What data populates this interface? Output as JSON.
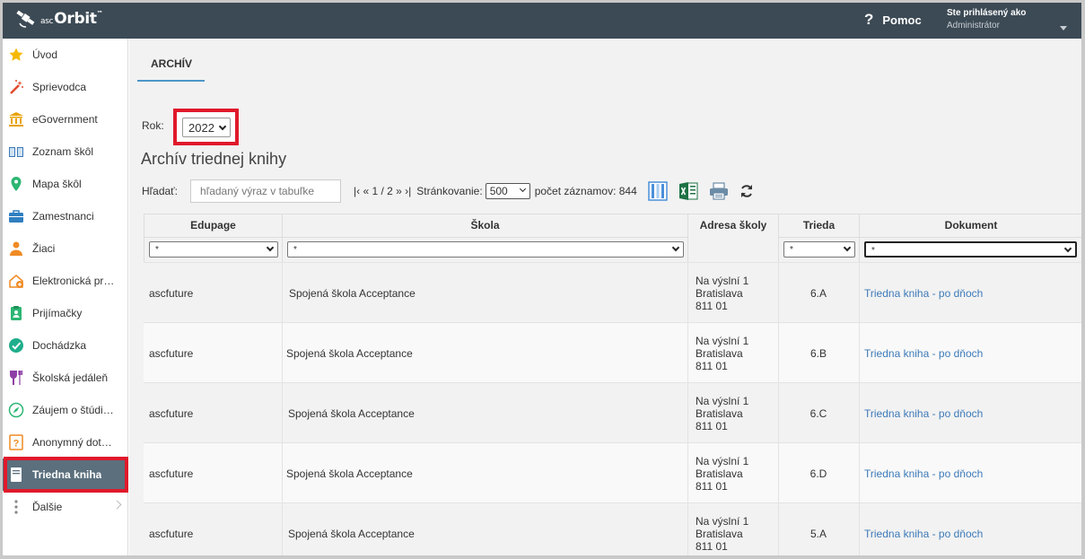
{
  "header": {
    "logo_small": "asc",
    "logo_text": "Orbit",
    "logo_tm": "™",
    "help_icon": "?",
    "help_label": "Pomoc",
    "user_line1": "Ste prihlásený ako",
    "user_line2": "Administrátor"
  },
  "sidebar": {
    "items": [
      {
        "label": "Úvod",
        "icon": "star-icon",
        "active": false
      },
      {
        "label": "Sprievodca",
        "icon": "wand-icon",
        "active": false
      },
      {
        "label": "eGovernment",
        "icon": "bank-icon",
        "active": false
      },
      {
        "label": "Zoznam škôl",
        "icon": "book-icon",
        "active": false
      },
      {
        "label": "Mapa škôl",
        "icon": "map-pin-icon",
        "active": false
      },
      {
        "label": "Zamestnanci",
        "icon": "briefcase-icon",
        "active": false
      },
      {
        "label": "Žiaci",
        "icon": "student-icon",
        "active": false
      },
      {
        "label": "Elektronická pr…",
        "icon": "application-icon",
        "active": false
      },
      {
        "label": "Prijímačky",
        "icon": "clipboard-user-icon",
        "active": false
      },
      {
        "label": "Dochádzka",
        "icon": "check-circle-icon",
        "active": false
      },
      {
        "label": "Školská jedáleň",
        "icon": "cutlery-icon",
        "active": false
      },
      {
        "label": "Záujem o štúdi…",
        "icon": "compass-icon",
        "active": false
      },
      {
        "label": "Anonymný dot…",
        "icon": "question-box-icon",
        "active": false
      },
      {
        "label": "Triedna kniha",
        "icon": "class-book-icon",
        "active": true
      },
      {
        "label": "Ďalšie",
        "icon": "more-dots-icon",
        "active": false
      }
    ]
  },
  "main": {
    "tab_label": "ARCHÍV",
    "rok_label": "Rok:",
    "rok_value": "2022",
    "title": "Archív triednej knihy",
    "search_label": "Hľadať:",
    "search_placeholder": "hľadaný výraz v tabuľke",
    "pager": "|‹ « 1 / 2 » ›|",
    "paging_label": "Stránkovanie:",
    "page_size": "500",
    "record_count": "počet záznamov: 844"
  },
  "table": {
    "columns": [
      "Edupage",
      "Škola",
      "Adresa školy",
      "Trieda",
      "Dokument"
    ],
    "filters": [
      "*",
      "*",
      "*",
      "*"
    ],
    "rows": [
      {
        "edupage": "ascfuture",
        "skola": "Spojená škola Acceptance",
        "addr1": "Na výslní 1",
        "addr2": "Bratislava",
        "addr3": "811 01",
        "trieda": "6.A",
        "dokument": "Triedna kniha - po dňoch"
      },
      {
        "edupage": "ascfuture",
        "skola": "Spojená škola Acceptance",
        "addr1": "Na výslní 1",
        "addr2": "Bratislava",
        "addr3": "811 01",
        "trieda": "6.B",
        "dokument": "Triedna kniha - po dňoch"
      },
      {
        "edupage": "ascfuture",
        "skola": "Spojená škola Acceptance",
        "addr1": "Na výslní 1",
        "addr2": "Bratislava",
        "addr3": "811 01",
        "trieda": "6.C",
        "dokument": "Triedna kniha - po dňoch"
      },
      {
        "edupage": "ascfuture",
        "skola": "Spojená škola Acceptance",
        "addr1": "Na výslní 1",
        "addr2": "Bratislava",
        "addr3": "811 01",
        "trieda": "6.D",
        "dokument": "Triedna kniha - po dňoch"
      },
      {
        "edupage": "ascfuture",
        "skola": "Spojená škola Acceptance",
        "addr1": "Na výslní 1",
        "addr2": "Bratislava",
        "addr3": "811 01",
        "trieda": "5.A",
        "dokument": "Triedna kniha - po dňoch"
      }
    ]
  },
  "colors": {
    "topbar": "#3c4a55",
    "active_item": "#5b6f7d",
    "highlight_red": "#e0192b",
    "link": "#3d7ab8",
    "tab_underline": "#4d96c9"
  }
}
